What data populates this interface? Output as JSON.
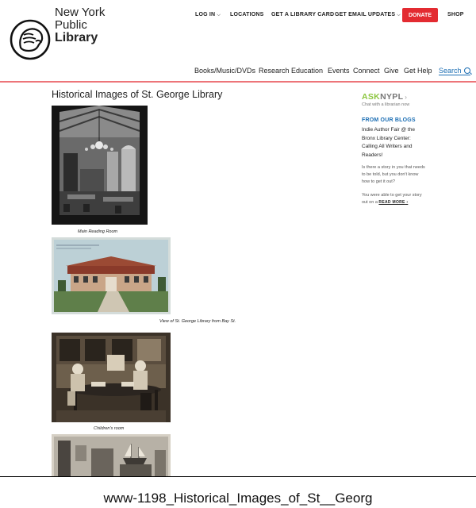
{
  "brand": {
    "line1": "New York",
    "line2": "Public",
    "line3": "Library"
  },
  "utility_nav": {
    "log_in": "LOG IN",
    "locations": "LOCATIONS",
    "library_card": "GET A LIBRARY CARD",
    "email_updates": "GET EMAIL UPDATES",
    "donate": "DONATE",
    "shop": "SHOP"
  },
  "main_nav": {
    "books": "Books/Music/DVDs",
    "research": "Research",
    "education": "Education",
    "events": "Events",
    "connect": "Connect",
    "give": "Give",
    "get_help": "Get Help",
    "search": "Search"
  },
  "colors": {
    "accent_red": "#e32b31",
    "link_blue": "#1a6db3",
    "ask_green": "#8cc63f"
  },
  "main": {
    "title": "Historical Images of St. George Library",
    "images": [
      {
        "caption": "Main Reading Room"
      },
      {
        "caption": "View of St. George Library from Bay St."
      },
      {
        "caption": "Children's room"
      }
    ]
  },
  "sidebar": {
    "ask_a": "ASK",
    "ask_b": "NYPL",
    "chat": "Chat with a librarian now",
    "blogs_heading": "FROM OUR BLOGS",
    "blog_title": "Indie Author Fair @ the Bronx Library Center: Calling All Writers and Readers!",
    "blog_p1": "Is there a story in you that needs to be told, but you don't know how to get it out?",
    "blog_p2": "You were able to get your story out on a",
    "read_more": "READ MORE"
  },
  "footer_label": "www-1198_Historical_Images_of_St__Georg"
}
